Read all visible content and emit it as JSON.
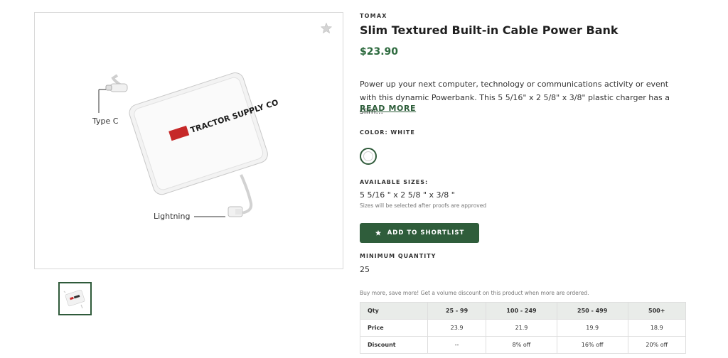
{
  "gallery": {
    "callouts": {
      "type_c": "Type C",
      "lightning": "Lightning"
    },
    "art_brand_text": "TRACTOR SUPPLY CO",
    "icons": {
      "favorite": "star-icon"
    }
  },
  "product": {
    "brand": "TOMAX",
    "title": "Slim Textured Built-in Cable Power Bank",
    "price": "$23.90",
    "description": "Power up your next computer, technology or communications activity or event with this dynamic Powerbank. This 5 5/16\" x 2 5/8\" x 3/8\" plastic charger has a slim...",
    "read_more": "READ MORE",
    "color_label": "COLOR: WHITE",
    "sizes_label": "AVAILABLE SIZES:",
    "size_value": "5 5/16 \" x 2 5/8 \" x 3/8 \"",
    "size_note": "Sizes will be selected after proofs are approved",
    "shortlist_label": "ADD TO SHORTLIST",
    "min_qty_label": "MINIMUM QUANTITY",
    "min_qty_value": "25",
    "volume_note": "Buy more, save more! Get a volume discount on this product when more are ordered."
  },
  "pricing_table": {
    "headers": [
      "Qty",
      "25 - 99",
      "100 - 249",
      "250 - 499",
      "500+"
    ],
    "rows": [
      {
        "label": "Price",
        "cells": [
          "23.9",
          "21.9",
          "19.9",
          "18.9"
        ]
      },
      {
        "label": "Discount",
        "cells": [
          "--",
          "8% off",
          "16% off",
          "20% off"
        ]
      }
    ]
  },
  "colors": {
    "accent": "#2f5d3b",
    "price": "#2d6a3e"
  }
}
